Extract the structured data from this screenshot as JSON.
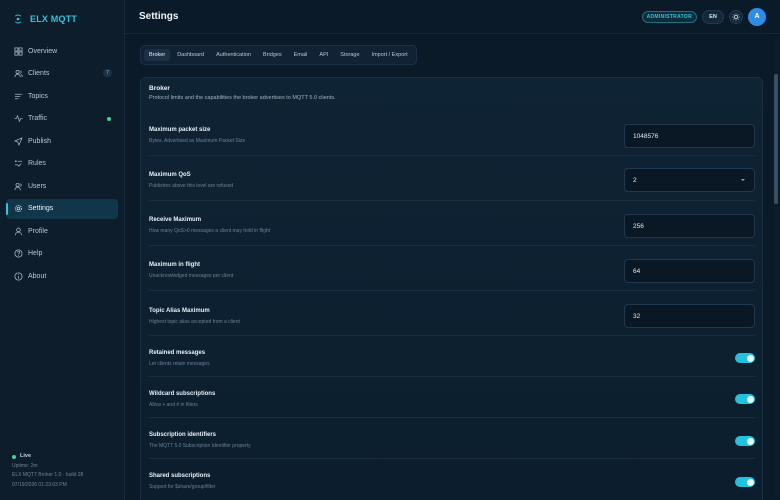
{
  "brand": {
    "name": "ELX MQTT",
    "accent": "#2ec5dd"
  },
  "sidebar": {
    "items": [
      {
        "label": "Overview",
        "icon": "grid-icon"
      },
      {
        "label": "Clients",
        "icon": "users-icon",
        "badge": "7"
      },
      {
        "label": "Topics",
        "icon": "list-icon"
      },
      {
        "label": "Traffic",
        "icon": "activity-icon",
        "status": "live-dot"
      },
      {
        "label": "Publish",
        "icon": "send-icon"
      },
      {
        "label": "Rules",
        "icon": "rules-icon"
      },
      {
        "label": "Users",
        "icon": "user-group-icon"
      },
      {
        "label": "Settings",
        "icon": "gear-icon",
        "active": true
      },
      {
        "label": "Profile",
        "icon": "person-icon"
      },
      {
        "label": "Help",
        "icon": "help-icon"
      },
      {
        "label": "About",
        "icon": "info-icon"
      }
    ],
    "footer": {
      "live": "Live",
      "uptime": "Uptime: 2m",
      "version": "ELX MQTT Broker 1.0 · build 28",
      "timestamp": "07/19/2026 01:23:03 PM"
    }
  },
  "header": {
    "title": "Settings",
    "role": "ADMINISTRATOR",
    "language": "EN",
    "avatar_initial": "A"
  },
  "tabs": [
    "Broker",
    "Dashboard",
    "Authentication",
    "Bridges",
    "Email",
    "API",
    "Storage",
    "Import / Export"
  ],
  "panel": {
    "title": "Broker",
    "description": "Protocol limits and the capabilities the broker advertises to MQTT 5.0 clients.",
    "settings": [
      {
        "label": "Maximum packet size",
        "help": "Bytes. Advertised as Maximum Packet Size",
        "type": "input",
        "value": "1048576"
      },
      {
        "label": "Maximum QoS",
        "help": "Publishes above this level are refused",
        "type": "select",
        "value": "2"
      },
      {
        "label": "Receive Maximum",
        "help": "How many QoS>0 messages a client may hold in flight",
        "type": "input",
        "value": "256"
      },
      {
        "label": "Maximum in flight",
        "help": "Unacknowledged messages per client",
        "type": "input",
        "value": "64"
      },
      {
        "label": "Topic Alias Maximum",
        "help": "Highest topic alias accepted from a client",
        "type": "input",
        "value": "32"
      },
      {
        "label": "Retained messages",
        "help": "Let clients retain messages",
        "type": "toggle",
        "on": true
      },
      {
        "label": "Wildcard subscriptions",
        "help": "Allow + and # in filters",
        "type": "toggle",
        "on": true
      },
      {
        "label": "Subscription identifiers",
        "help": "The MQTT 5.0 Subscription Identifier property",
        "type": "toggle",
        "on": true
      },
      {
        "label": "Shared subscriptions",
        "help": "Support for $share/group/filter",
        "type": "toggle",
        "on": true
      }
    ]
  }
}
